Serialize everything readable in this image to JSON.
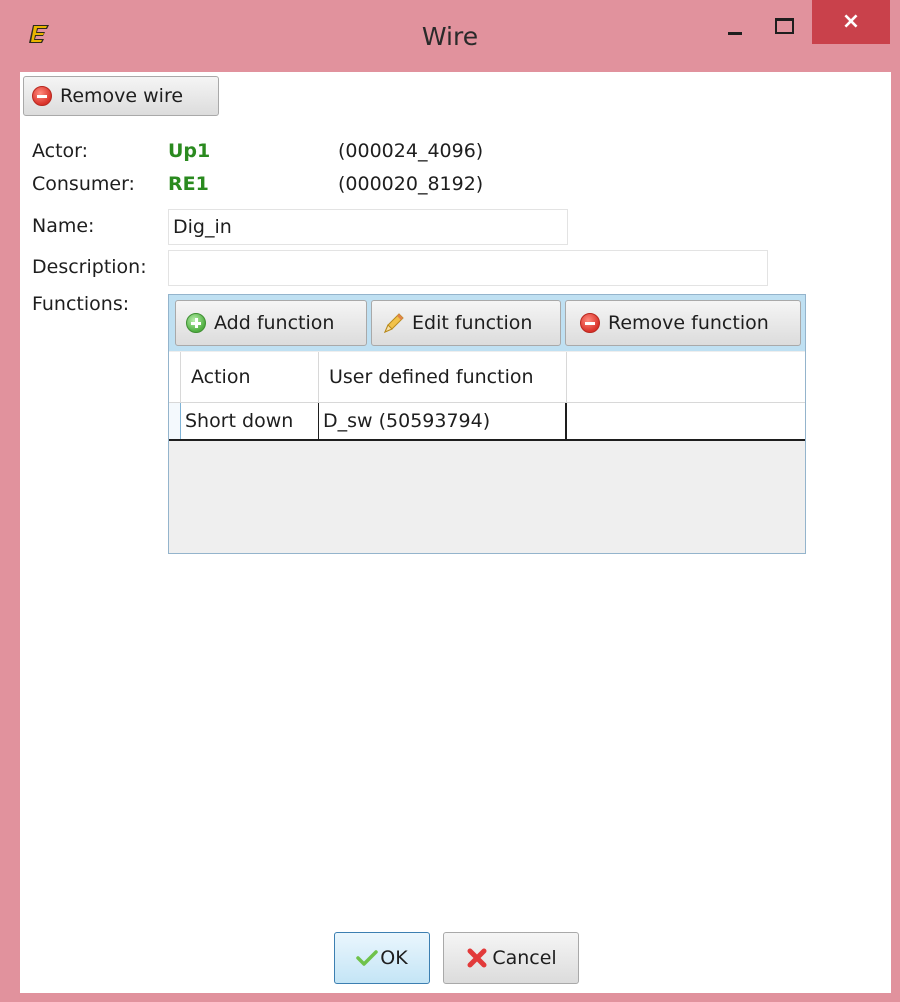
{
  "window": {
    "title": "Wire",
    "app_icon": "E",
    "close_glyph": "×",
    "frame_color": "#e1929d",
    "close_color": "#c9414b"
  },
  "toolbar": {
    "remove_wire_label": "Remove wire"
  },
  "form": {
    "actor": {
      "label": "Actor:",
      "value": "Up1",
      "id": "(000024_4096)"
    },
    "consumer": {
      "label": "Consumer:",
      "value": "RE1",
      "id": "(000020_8192)"
    },
    "name": {
      "label": "Name:",
      "value": "Dig_in"
    },
    "description": {
      "label": "Description:",
      "value": ""
    },
    "functions": {
      "label": "Functions:"
    }
  },
  "functions_panel": {
    "buttons": {
      "add": "Add function",
      "edit": "Edit function",
      "remove": "Remove function"
    },
    "columns": [
      "Action",
      "User defined function",
      ""
    ],
    "rows": [
      {
        "action": "Short down",
        "function": "D_sw (50593794)"
      }
    ]
  },
  "footer": {
    "ok_label": "OK",
    "cancel_label": "Cancel"
  },
  "icons": {
    "remove": "minus-circle-icon",
    "add": "plus-circle-icon",
    "edit": "pencil-icon",
    "ok": "checkmark-icon",
    "cancel": "red-x-icon"
  },
  "colors": {
    "accent_green": "#2a8a1f",
    "panel_header": "#bfe0f2"
  }
}
